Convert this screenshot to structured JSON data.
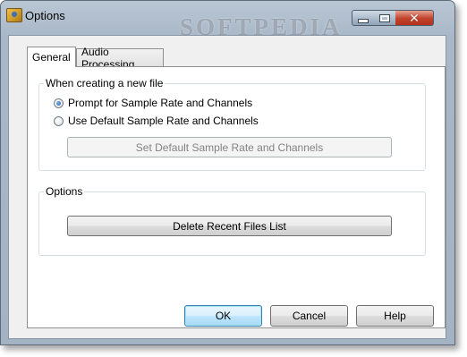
{
  "window": {
    "title": "Options",
    "watermark": "SOFTPEDIA"
  },
  "tabs": [
    {
      "label": "General",
      "selected": true
    },
    {
      "label": "Audio Processing",
      "selected": false
    }
  ],
  "group_new_file": {
    "legend": "When creating a new file",
    "options": [
      {
        "label": "Prompt for Sample Rate and Channels",
        "checked": true
      },
      {
        "label": "Use Default Sample Rate and Channels",
        "checked": false
      }
    ],
    "set_default_button": "Set Default Sample Rate and Channels"
  },
  "group_options": {
    "legend": "Options",
    "delete_recent_button": "Delete Recent Files List"
  },
  "footer": {
    "ok": "OK",
    "cancel": "Cancel",
    "help": "Help"
  }
}
